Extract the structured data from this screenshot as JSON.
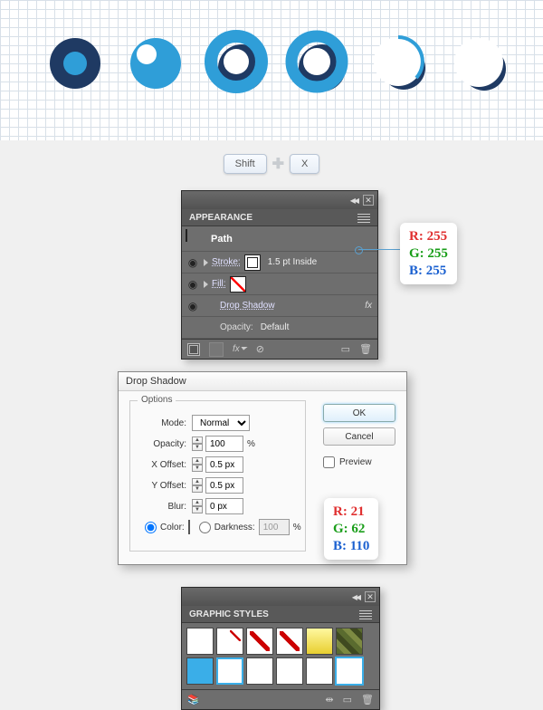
{
  "keys": {
    "shift": "Shift",
    "x": "X"
  },
  "appearance": {
    "title": "APPEARANCE",
    "path": "Path",
    "stroke_label": "Stroke:",
    "stroke_info": "1.5 pt  Inside",
    "fill_label": "Fill:",
    "dropshadow": "Drop Shadow",
    "opacity_label": "Opacity:",
    "opacity_value": "Default",
    "fx": "fx"
  },
  "rgb_stroke": {
    "r": "R: 255",
    "g": "G: 255",
    "b": "B: 255"
  },
  "dropshadow": {
    "title": "Drop Shadow",
    "legend": "Options",
    "mode_label": "Mode:",
    "mode": "Normal",
    "opacity_label": "Opacity:",
    "opacity": "100",
    "xoff_label": "X Offset:",
    "xoff": "0.5 px",
    "yoff_label": "Y Offset:",
    "yoff": "0.5 px",
    "blur_label": "Blur:",
    "blur": "0 px",
    "color_label": "Color:",
    "darkness_label": "Darkness:",
    "darkness": "100",
    "pct": "%",
    "ok": "OK",
    "cancel": "Cancel",
    "preview": "Preview"
  },
  "rgb_shadow": {
    "r": "R: 21",
    "g": "G: 62",
    "b": "B: 110"
  },
  "gstyles": {
    "title": "GRAPHIC STYLES"
  },
  "colors": {
    "navy": "#1f3a63",
    "blue": "#2f9ed8"
  }
}
